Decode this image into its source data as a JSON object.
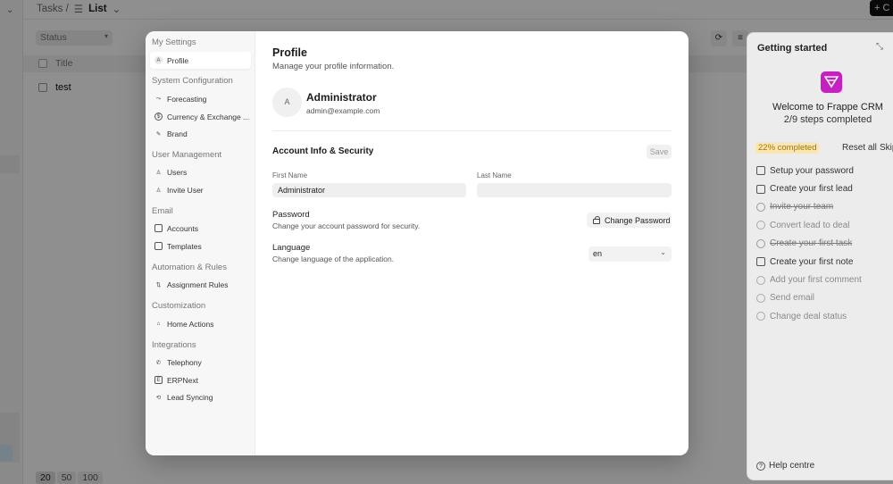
{
  "background": {
    "breadcrumb": {
      "root": "Tasks /",
      "view_icon": "list-icon",
      "current": "List"
    },
    "create_button": "+ C",
    "filter": {
      "status_placeholder": "Status"
    },
    "table": {
      "column_title": "Title",
      "rows": [
        "test"
      ]
    },
    "pagination": [
      "20",
      "50",
      "100"
    ]
  },
  "getting_started": {
    "title": "Getting started",
    "welcome": "Welcome to Frappe CRM",
    "steps": "2/9 steps completed",
    "progress_badge": "22% completed",
    "progress_fraction": 0.22,
    "reset_label": "Reset all",
    "skip_label": "Skip",
    "items": [
      {
        "label": "Setup your password",
        "state": "todo"
      },
      {
        "label": "Create your first lead",
        "state": "todo"
      },
      {
        "label": "Invite your team",
        "state": "done"
      },
      {
        "label": "Convert lead to deal",
        "state": "pending"
      },
      {
        "label": "Create your first task",
        "state": "done"
      },
      {
        "label": "Create your first note",
        "state": "todo"
      },
      {
        "label": "Add your first comment",
        "state": "pending"
      },
      {
        "label": "Send email",
        "state": "pending"
      },
      {
        "label": "Change deal status",
        "state": "pending"
      }
    ],
    "help": "Help centre",
    "brand_color": "#c71fc2"
  },
  "settings": {
    "sections": [
      {
        "heading": "My Settings",
        "items": [
          {
            "label": "Profile",
            "icon": "avatar-icon",
            "active": true
          }
        ]
      },
      {
        "heading": "System Configuration",
        "items": [
          {
            "label": "Forecasting",
            "icon": "forecast-icon"
          },
          {
            "label": "Currency & Exchange ...",
            "icon": "currency-icon"
          },
          {
            "label": "Brand",
            "icon": "brand-icon"
          }
        ]
      },
      {
        "heading": "User Management",
        "items": [
          {
            "label": "Users",
            "icon": "user-icon"
          },
          {
            "label": "Invite User",
            "icon": "invite-user-icon"
          }
        ]
      },
      {
        "heading": "Email",
        "items": [
          {
            "label": "Accounts",
            "icon": "mail-icon"
          },
          {
            "label": "Templates",
            "icon": "template-icon"
          }
        ]
      },
      {
        "heading": "Automation & Rules",
        "items": [
          {
            "label": "Assignment Rules",
            "icon": "assignment-icon"
          }
        ]
      },
      {
        "heading": "Customization",
        "items": [
          {
            "label": "Home Actions",
            "icon": "home-icon"
          }
        ]
      },
      {
        "heading": "Integrations",
        "items": [
          {
            "label": "Telephony",
            "icon": "phone-icon"
          },
          {
            "label": "ERPNext",
            "icon": "erpnext-icon"
          },
          {
            "label": "Lead Syncing",
            "icon": "sync-icon"
          }
        ]
      }
    ],
    "profile": {
      "title": "Profile",
      "subtitle": "Manage your profile information.",
      "avatar_letter": "A",
      "name": "Administrator",
      "email": "admin@example.com",
      "account_title": "Account Info & Security",
      "save_label": "Save",
      "first_name_label": "First Name",
      "first_name_value": "Administrator",
      "last_name_label": "Last Name",
      "last_name_value": "",
      "password_title": "Password",
      "password_desc": "Change your account password for security.",
      "change_password_label": "Change Password",
      "language_title": "Language",
      "language_desc": "Change language of the application.",
      "language_value": "en"
    }
  }
}
